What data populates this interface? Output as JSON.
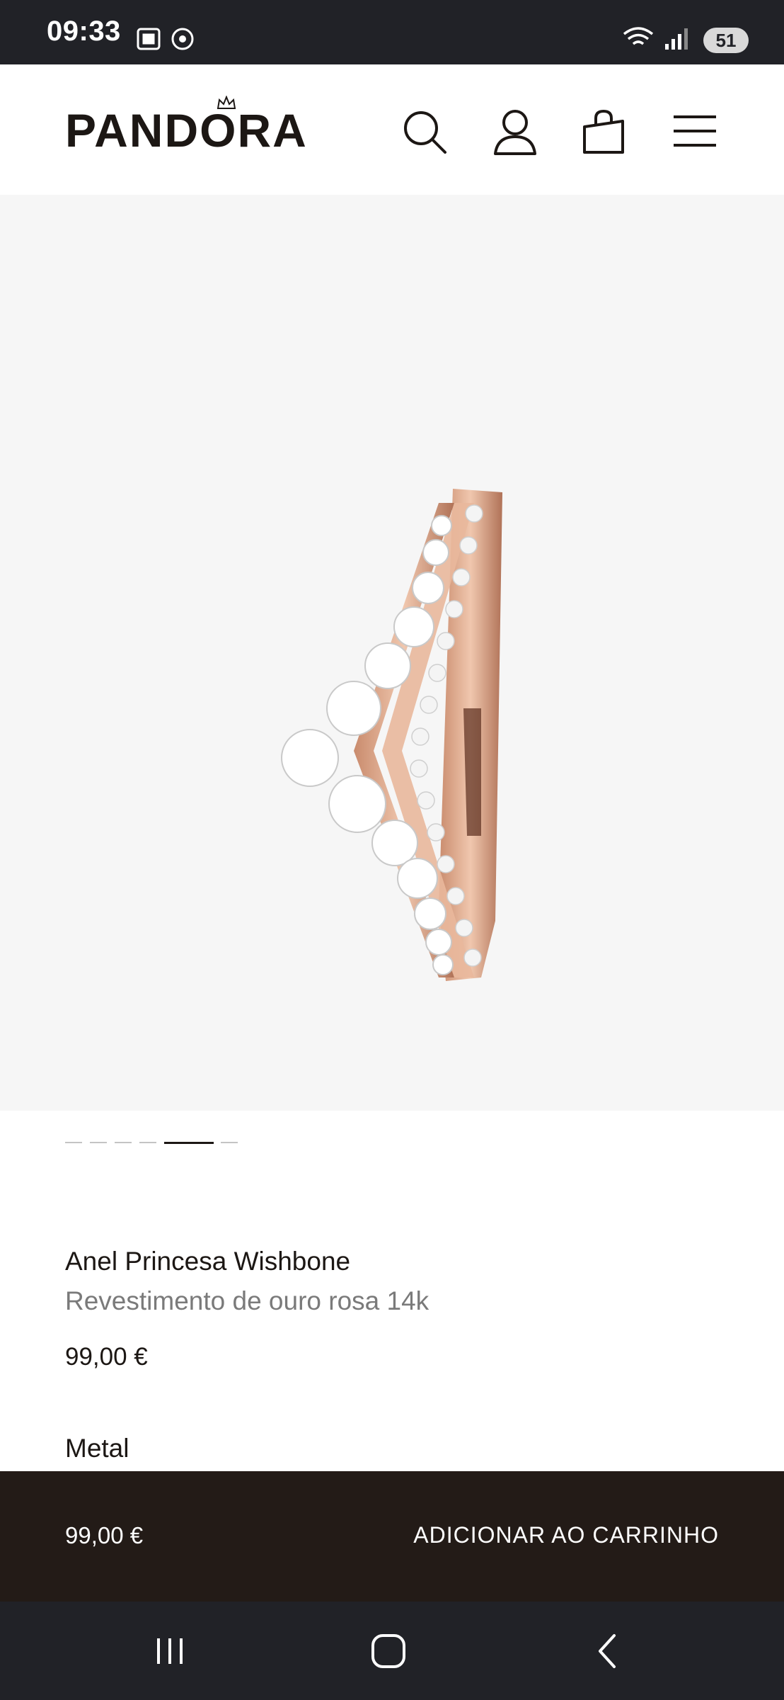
{
  "status": {
    "time": "09:33",
    "battery": "51"
  },
  "header": {
    "brand": "PANDORA",
    "icons": [
      "search-icon",
      "account-icon",
      "bag-icon",
      "menu-icon"
    ]
  },
  "product": {
    "title": "Anel Princesa Wishbone",
    "subtitle": "Revestimento de ouro rosa 14k",
    "price": "99,00 €",
    "section_metal": "Metal"
  },
  "carousel": {
    "count": 6,
    "active_index": 4
  },
  "cart_bar": {
    "price": "99,00 €",
    "button": "ADICIONAR AO CARRINHO"
  },
  "colors": {
    "header_text": "#1c1714",
    "cart_bar_bg": "#231b17",
    "image_bg": "#f6f6f6",
    "system_bar": "#212227",
    "rose_gold": "#d9a58a"
  }
}
